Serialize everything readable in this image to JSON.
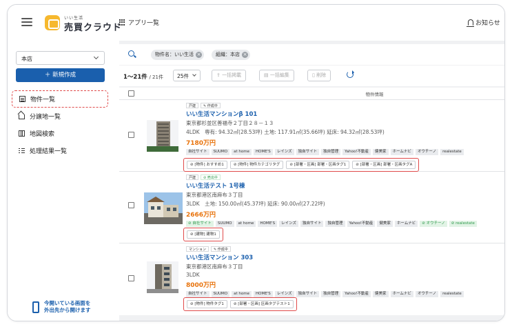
{
  "app": {
    "brand_sub": "いい生活",
    "brand_main": "売買クラウド",
    "apps_label": "アプリ一覧",
    "notice_label": "お知らせ"
  },
  "sidebar": {
    "store_select_value": "本店",
    "new_button_label": "＋ 新規作成",
    "items": [
      {
        "label": "物件一覧",
        "icon": "list-icon",
        "active": true
      },
      {
        "label": "分譲地一覧",
        "icon": "house-icon",
        "active": false
      },
      {
        "label": "地図検索",
        "icon": "map-icon",
        "active": false
      },
      {
        "label": "処理結果一覧",
        "icon": "results-list-icon",
        "active": false
      }
    ],
    "promo_line1": "今開いている画面を",
    "promo_line2": "外出先から開けます"
  },
  "filters": {
    "chips": [
      "物件名：いい生活",
      "組織：本店"
    ]
  },
  "toolbar": {
    "count_range": "1〜21件",
    "count_total": "/ 21件",
    "per_page": "25件",
    "bulk_publish": "一括掲載",
    "bulk_edit": "一括編集",
    "delete": "削除"
  },
  "table": {
    "header": "物件情報",
    "rows": [
      {
        "badges": [
          "戸建",
          "作成中"
        ],
        "title": "いい生活マンションβ 101",
        "address": "東京都杉並区善福寺２丁目２８－１３",
        "specs": "4LDK　専有: 94.32㎡(28.53坪) 土地: 117.91㎡(35.66坪) 延床: 94.32㎡(28.53坪)",
        "price": "7180万円",
        "portals": [
          "自社サイト",
          "SUUMO",
          "at home",
          "HOME'S",
          "レインズ",
          "独自サイト",
          "独自管理",
          "Yahoo!不動産",
          "健美家",
          "ホームナビ",
          "オウチーノ",
          "realestate"
        ],
        "tags": [
          "[物件] おすすめ1",
          "[物件] 物件カテゴリタグ",
          "[部署・区画] 部署・区画タグ1",
          "[部署・区画] 部署・区画タグA"
        ]
      },
      {
        "badges": [
          "戸建",
          "売出中"
        ],
        "title": "いい生活テスト 1号棟",
        "address": "東京都港区南麻布３丁目",
        "specs": "3LDK　土地: 150.00㎡(45.37坪) 延床: 90.00㎡(27.22坪)",
        "price": "2666万円",
        "portals": [
          "自社サイト",
          "SUUMO",
          "at home",
          "HOME'S",
          "レインズ",
          "独自サイト",
          "独自管理",
          "Yahoo!不動産",
          "健美家",
          "ホームナビ",
          "オウチーノ",
          "realestate"
        ],
        "tags": [
          "[建物] 建物1"
        ]
      },
      {
        "badges": [
          "マンション",
          "作成中"
        ],
        "title": "いい生活マンション 303",
        "address": "東京都港区南麻布３丁目",
        "specs": "3LDK",
        "price": "8000万円",
        "portals": [
          "自社サイト",
          "SUUMO",
          "at home",
          "HOME'S",
          "レインズ",
          "独自サイト",
          "独自管理",
          "Yahoo!不動産",
          "健美家",
          "ホームナビ",
          "オウチーノ",
          "realestate"
        ],
        "tags": [
          "[物件] 物件タグ1",
          "[部署・区画] 区画タグテスト1"
        ]
      }
    ]
  },
  "colors": {
    "primary": "#1a5fad",
    "price": "#e8730c",
    "highlight": "#e04a4a",
    "brand": "#f6b82e"
  }
}
